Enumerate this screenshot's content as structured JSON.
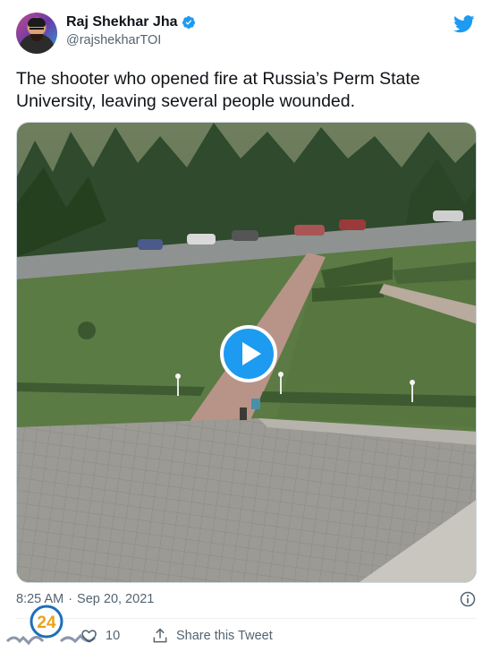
{
  "author": {
    "display_name": "Raj Shekhar Jha",
    "handle": "@rajshekharTOI"
  },
  "tweet": {
    "text": "The shooter who opened fire at Russia’s Perm State University, leaving several people wounded.",
    "time": "8:25 AM",
    "separator": "·",
    "date": "Sep 20, 2021"
  },
  "actions": {
    "like_count": "10",
    "share_label": "Share this Tweet"
  },
  "watermark": {
    "number": "24"
  },
  "colors": {
    "accent": "#1d9bf0",
    "text": "#0f1419",
    "secondary": "#536471"
  },
  "icons": [
    "verified-badge-icon",
    "twitter-bird-icon",
    "play-icon",
    "info-icon",
    "heart-icon",
    "share-icon"
  ]
}
